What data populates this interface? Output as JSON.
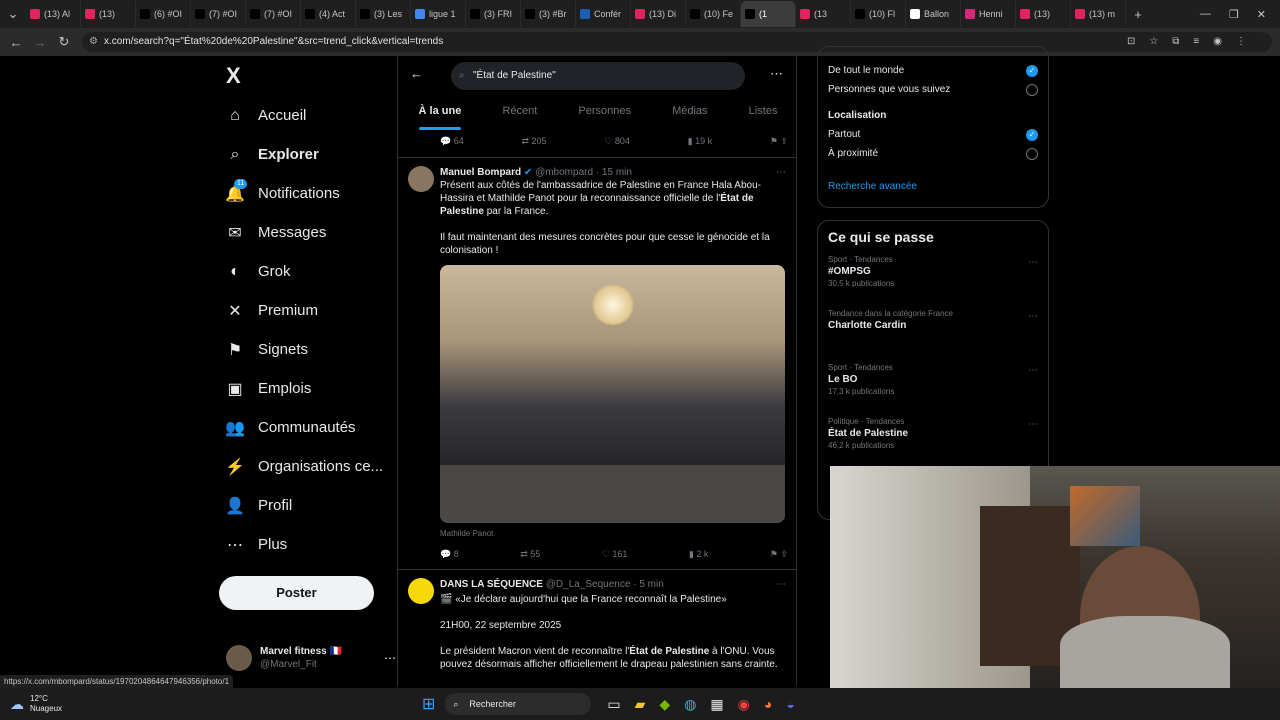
{
  "browser": {
    "tabs": [
      {
        "label": "(13) Al",
        "color": "#e0245e"
      },
      {
        "label": "(13)",
        "color": "#e0245e"
      },
      {
        "label": "(6) #OI",
        "color": "#000"
      },
      {
        "label": "(7) #OI",
        "color": "#000"
      },
      {
        "label": "(7) #OI",
        "color": "#000"
      },
      {
        "label": "(4) Act",
        "color": "#000"
      },
      {
        "label": "(3) Les",
        "color": "#000"
      },
      {
        "label": "ligue 1",
        "color": "#4285f4"
      },
      {
        "label": "(3) FRI",
        "color": "#000"
      },
      {
        "label": "(3) #Br",
        "color": "#000"
      },
      {
        "label": "Confér",
        "color": "#1a5fb4"
      },
      {
        "label": "(13) Di",
        "color": "#e0245e"
      },
      {
        "label": "(10) Fe",
        "color": "#000"
      },
      {
        "label": "(1",
        "color": "#000"
      },
      {
        "label": "(13",
        "color": "#e0245e"
      },
      {
        "label": "(10) Fl",
        "color": "#000"
      },
      {
        "label": "Ballon",
        "color": "#fff"
      },
      {
        "label": "Henni",
        "color": "#d62976"
      },
      {
        "label": "(13)",
        "color": "#e0245e"
      },
      {
        "label": "(13) m",
        "color": "#e0245e"
      }
    ],
    "url": "x.com/search?q=\"État%20de%20Palestine\"&src=trend_click&vertical=trends",
    "status_url": "https://x.com/mbompard/status/1970204864647946356/photo/1"
  },
  "nav": {
    "logo": "X",
    "items": [
      {
        "label": "Accueil",
        "icon": "home-icon",
        "glyph": "⌂"
      },
      {
        "label": "Explorer",
        "icon": "search-icon",
        "glyph": "⌕",
        "bold": true
      },
      {
        "label": "Notifications",
        "icon": "bell-icon",
        "glyph": "🔔",
        "badge": "11"
      },
      {
        "label": "Messages",
        "icon": "envelope-icon",
        "glyph": "✉"
      },
      {
        "label": "Grok",
        "icon": "grok-icon",
        "glyph": "◐"
      },
      {
        "label": "Premium",
        "icon": "x-icon",
        "glyph": "✕"
      },
      {
        "label": "Signets",
        "icon": "bookmark-icon",
        "glyph": "⚑"
      },
      {
        "label": "Emplois",
        "icon": "briefcase-icon",
        "glyph": "▣"
      },
      {
        "label": "Communautés",
        "icon": "people-icon",
        "glyph": "👥"
      },
      {
        "label": "Organisations ce...",
        "icon": "lightning-icon",
        "glyph": "⚡"
      },
      {
        "label": "Profil",
        "icon": "person-icon",
        "glyph": "👤"
      },
      {
        "label": "Plus",
        "icon": "more-circle-icon",
        "glyph": "⋯"
      }
    ],
    "post_button": "Poster",
    "account": {
      "name": "Marvel fitness 🇫🇷",
      "handle": "@Marvel_Fit"
    }
  },
  "search": {
    "query": "\"État de Palestine\"",
    "tabs": [
      "À la une",
      "Récent",
      "Personnes",
      "Médias",
      "Listes"
    ]
  },
  "top_actions": {
    "replies": "64",
    "reposts": "205",
    "likes": "804",
    "views": "19 k"
  },
  "tweets": [
    {
      "name": "Manuel Bompard",
      "handle": "@mbompard",
      "time": "· 15 min",
      "text1": "Présent aux côtés de l'ambassadrice de Palestine en France Hala Abou-Hassira et Mathilde Panot pour la reconnaissance officielle de l'",
      "bold1": "État de Palestine",
      "text1b": " par la France.",
      "text2": "Il faut maintenant des mesures concrètes pour que cesse le génocide et la colonisation !",
      "photo_caption": "Mathilde Panot",
      "replies": "8",
      "reposts": "55",
      "likes": "161",
      "views": "2 k"
    },
    {
      "name": "DANS LA SÉQUENCE",
      "handle": "@D_La_Sequence",
      "time": "· 5 min",
      "text1": "«Je déclare aujourd'hui que la France reconnaît la Palestine»",
      "text2": "21H00, 22 septembre 2025",
      "text3a": "Le président Macron vient de reconnaître l'",
      "bold3": "État de Palestine",
      "text3b": " à l'ONU. Vous pouvez désormais afficher officiellement le drapeau palestinien sans crainte."
    }
  ],
  "filters": {
    "people": [
      {
        "label": "De tout le monde",
        "checked": true
      },
      {
        "label": "Personnes que vous suivez",
        "checked": false
      }
    ],
    "location_title": "Localisation",
    "location": [
      {
        "label": "Partout",
        "checked": true
      },
      {
        "label": "À proximité",
        "checked": false
      }
    ],
    "advanced": "Recherche avancée"
  },
  "trends": {
    "title": "Ce qui se passe",
    "items": [
      {
        "context": "Sport · Tendances",
        "name": "#OMPSG",
        "count": "30,5 k publications"
      },
      {
        "context": "Tendance dans la catégorie France",
        "name": "Charlotte Cardin",
        "count": ""
      },
      {
        "context": "Sport · Tendances",
        "name": "Le BO",
        "count": "17,3 k publications"
      },
      {
        "context": "Politique · Tendances",
        "name": "État de Palestine",
        "count": "46,2 k publications"
      }
    ]
  },
  "taskbar": {
    "temp": "12°C",
    "weather": "Nuageux",
    "search": "Rechercher"
  },
  "colors": {
    "accent": "#1d9bf0",
    "bg": "#000000",
    "border": "#2f3336",
    "muted": "#71767b"
  }
}
